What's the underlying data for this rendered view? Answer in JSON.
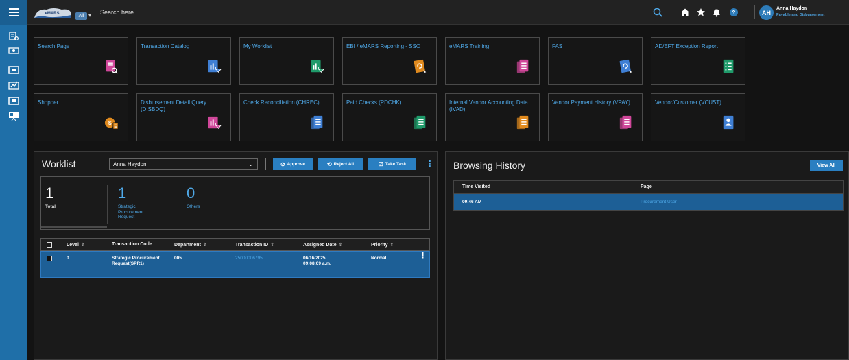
{
  "topbar": {
    "logo_text": "eMARS",
    "scope_label": "All",
    "search_placeholder": "Search here...",
    "user": {
      "initials": "AH",
      "name": "Anna Haydon",
      "role": "Payable and Disbursement"
    }
  },
  "rail": {
    "icons": [
      "document-search-icon",
      "card-icon",
      "money-icon",
      "signature-icon",
      "money-icon",
      "presentation-icon"
    ]
  },
  "tiles": [
    {
      "label": "Search Page",
      "icon": "document-search-icon",
      "color": "#d0479a"
    },
    {
      "label": "Transaction Catalog",
      "icon": "document-chart-icon",
      "color": "#3f7fd4"
    },
    {
      "label": "My Worklist",
      "icon": "document-chart-icon",
      "color": "#1f9a6a"
    },
    {
      "label": "EBI / eMARS Reporting - SSO",
      "icon": "document-link-icon",
      "color": "#e08a1e"
    },
    {
      "label": "eMARS Training",
      "icon": "documents-icon",
      "color": "#d0479a"
    },
    {
      "label": "FAS",
      "icon": "document-link-icon",
      "color": "#3f7fd4"
    },
    {
      "label": "AD/EFT Exception Report",
      "icon": "document-list-icon",
      "color": "#1f9a6a"
    },
    {
      "label": "Shopper",
      "icon": "coins-icon",
      "color": "#e08a1e"
    },
    {
      "label": "Disbursement Detail Query (DISBDQ)",
      "icon": "document-chart-icon",
      "color": "#d0479a"
    },
    {
      "label": "Check Reconciliation (CHREC)",
      "icon": "documents-icon",
      "color": "#3f7fd4"
    },
    {
      "label": "Paid Checks (PDCHK)",
      "icon": "documents-icon",
      "color": "#1f9a6a"
    },
    {
      "label": "Internal Vendor Accounting Data (IVAD)",
      "icon": "documents-icon",
      "color": "#e08a1e"
    },
    {
      "label": "Vendor Payment History (VPAY)",
      "icon": "documents-icon",
      "color": "#d0479a"
    },
    {
      "label": "Vendor/Customer (VCUST)",
      "icon": "contact-card-icon",
      "color": "#3f7fd4"
    }
  ],
  "worklist": {
    "title": "Worklist",
    "selected_user": "Anna Haydon",
    "buttons": {
      "approve": "Approve",
      "reject_all": "Reject All",
      "take_task": "Take Task"
    },
    "stats": [
      {
        "count": "1",
        "label": "Total"
      },
      {
        "count": "1",
        "label": "Strategic Procurement Request"
      },
      {
        "count": "0",
        "label": "Others"
      }
    ],
    "columns": [
      "Level",
      "Transaction Code",
      "Department",
      "Transaction ID",
      "Assigned Date",
      "Priority"
    ],
    "rows": [
      {
        "level": "0",
        "transaction_code": "Strategic Procurement Request(SPR1)",
        "department": "005",
        "transaction_id": "25000006795",
        "assigned_date": "06/16/2025",
        "assigned_time": "09:08:09 a.m.",
        "priority": "Normal"
      }
    ]
  },
  "browsing_history": {
    "title": "Browsing History",
    "view_all": "View All",
    "columns": [
      "Time Visited",
      "Page"
    ],
    "rows": [
      {
        "time": "09:46 AM",
        "page": "Procurement User"
      }
    ]
  },
  "colors": {
    "accent": "#2a7fc1",
    "link": "#4fa9e8",
    "rail": "#1f6fa8",
    "selected_row": "#1d5f96"
  }
}
